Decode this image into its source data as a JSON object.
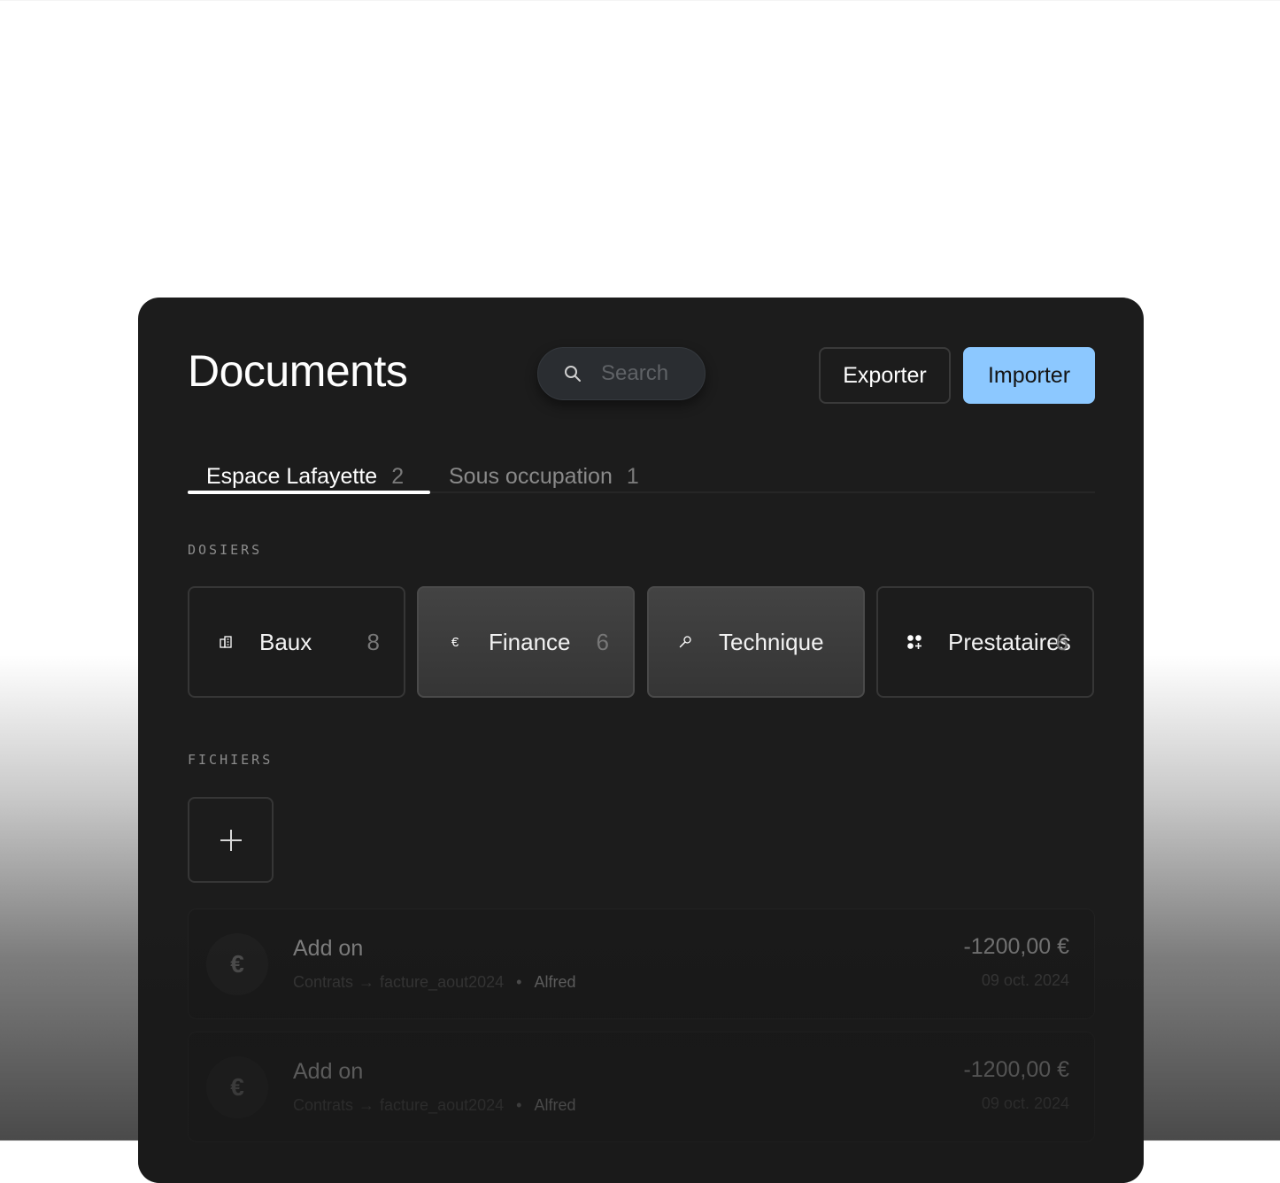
{
  "header": {
    "title": "Documents",
    "search_placeholder": "Search",
    "export_label": "Exporter",
    "import_label": "Importer"
  },
  "tabs": [
    {
      "label": "Espace Lafayette",
      "count": "2",
      "active": true
    },
    {
      "label": "Sous occupation",
      "count": "1",
      "active": false
    }
  ],
  "sections": {
    "folders_label": "DOSIERS",
    "files_label": "FICHIERS"
  },
  "folders": [
    {
      "label": "Baux",
      "count": "8",
      "icon": "building-icon"
    },
    {
      "label": "Finance",
      "count": "6",
      "icon": "euro-icon"
    },
    {
      "label": "Technique",
      "count": "",
      "icon": "wrench-icon"
    },
    {
      "label": "Prestataires",
      "count": "6",
      "icon": "grid-plus-icon"
    }
  ],
  "add_file_icon": "plus-icon",
  "files": [
    {
      "name": "Add on",
      "folder": "Contrats",
      "file": "facture_aout2024",
      "author": "Alfred",
      "amount": "-1200,00 €",
      "date": "09 oct. 2024",
      "icon": "€"
    },
    {
      "name": "Add on",
      "folder": "Contrats",
      "file": "facture_aout2024",
      "author": "Alfred",
      "amount": "-1200,00 €",
      "date": "09 oct. 2024",
      "icon": "€"
    }
  ],
  "colors": {
    "panel": "#1c1c1c",
    "accent": "#8cc8ff",
    "text": "#ffffff",
    "muted": "#8a8a8a"
  }
}
